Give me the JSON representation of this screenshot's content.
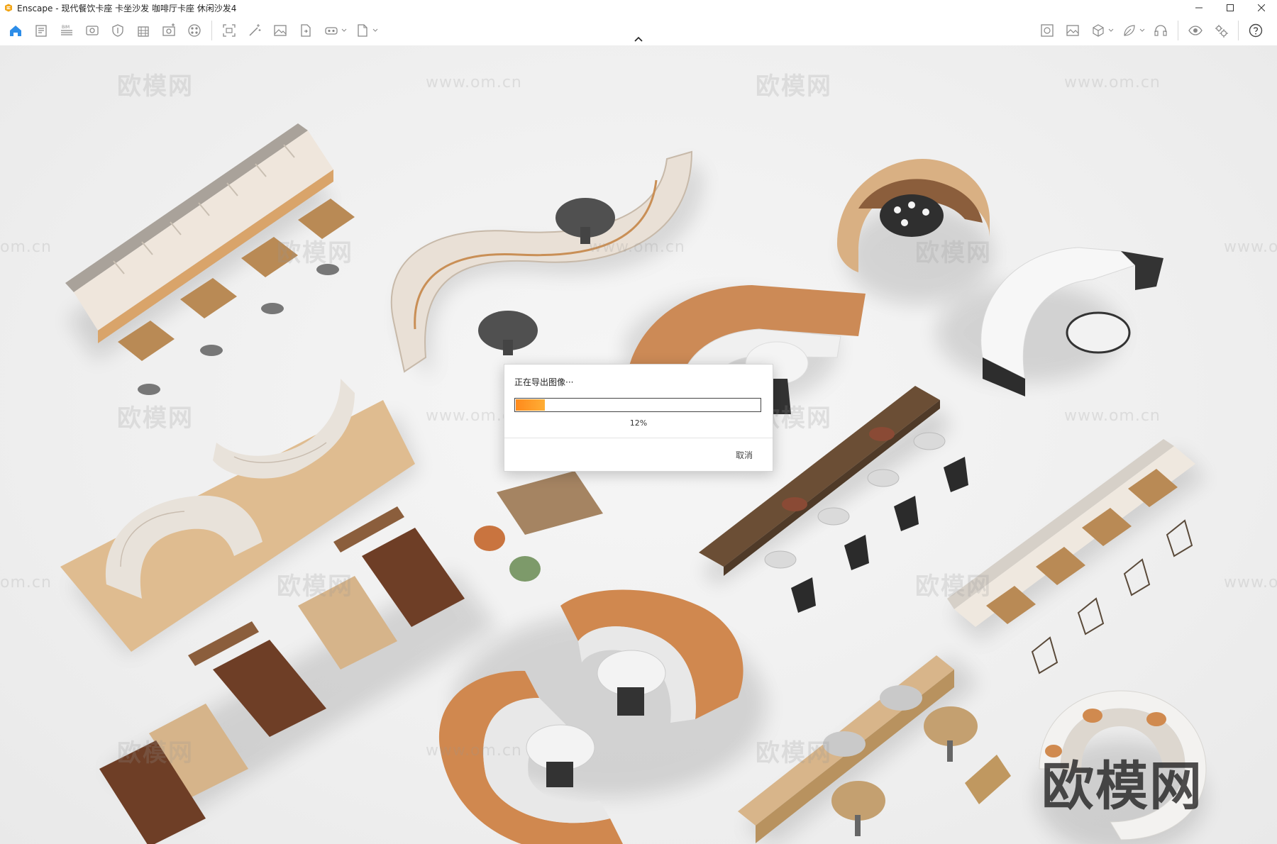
{
  "window": {
    "title": "Enscape - 现代餐饮卡座 卡坐沙发 咖啡厅卡座 休闲沙发4",
    "controls": {
      "minimize": "—",
      "maximize": "☐",
      "close": "✕"
    }
  },
  "toolbar": {
    "left_icons": [
      "home-icon",
      "notes-icon",
      "bim-icon",
      "view-icon",
      "shield-icon",
      "building-icon",
      "video-add-icon",
      "asset-library-icon",
      "screenshot-icon",
      "magic-wand-icon",
      "image-icon",
      "export-file-icon",
      "vr-headset-icon",
      "document-icon"
    ],
    "right_icons": [
      "material-icon",
      "photo-icon",
      "cube-icon",
      "leaf-icon",
      "headset-icon",
      "eye-icon",
      "settings-icon",
      "help-icon"
    ],
    "accent_color": "#2d8de8"
  },
  "viewport": {
    "watermarks": [
      {
        "text": "欧模网"
      },
      {
        "text": "www.om.cn"
      },
      {
        "text": "欧模网"
      },
      {
        "text": "www.om.cn"
      },
      {
        "text": "om.cn"
      },
      {
        "text": "欧模网"
      },
      {
        "text": "www.om.cn"
      },
      {
        "text": "欧模网"
      },
      {
        "text": "www.om.cn"
      },
      {
        "text": "欧模网"
      },
      {
        "text": "www.om.cn"
      },
      {
        "text": "欧模网"
      },
      {
        "text": "www.om.cn"
      },
      {
        "text": "om.cn"
      },
      {
        "text": "欧模网"
      },
      {
        "text": "欧模网"
      },
      {
        "text": "欧模网"
      },
      {
        "text": "www.om.cn"
      },
      {
        "text": "欧模网"
      },
      {
        "text": "www.om.cn"
      }
    ],
    "brand_watermark": "欧模网"
  },
  "export_dialog": {
    "title": "正在导出图像···",
    "progress": 0.12,
    "percent_label": "12%",
    "cancel_label": "取消",
    "progress_color": "#ff8a1c"
  }
}
